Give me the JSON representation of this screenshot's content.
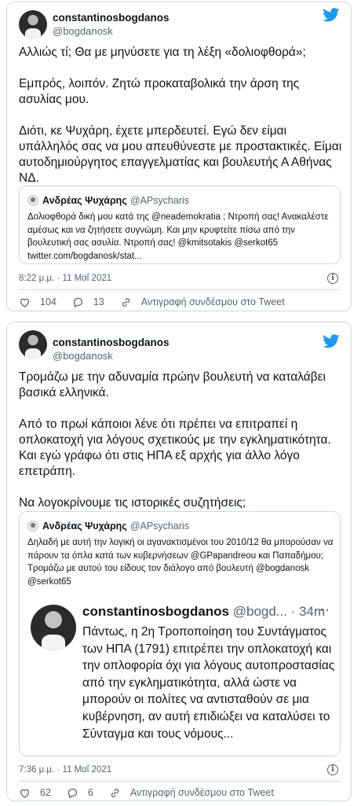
{
  "tweets": [
    {
      "author_name": "constantinosbogdanos",
      "author_handle": "@bogdanosk",
      "text": [
        "Αλλιώς τί; Θα με μηνύσετε για τη λέξη «δολιοφθορά»;",
        "Εμπρός, λοιπόν. Ζητώ προκαταβολικά την άρση της ασυλίας μου.",
        "Διότι, κε Ψυχάρη, έχετε μπερδευτεί. Εγώ δεν είμαι υπάλληλός σας να μου απευθύνεστε με προστακτικές. Είμαι αυτοδημιούργητος επαγγελματίας και βουλευτής Α Αθήνας ΝΔ."
      ],
      "quote": {
        "name": "Ανδρέας Ψυχάρης",
        "handle": "@APsycharis",
        "text": "Δολιοφθορά δική μου κατά της @neademokratia ; Ντροπή σας! Ανακαλέστε αμέσως και να ζητήσετε συγνώμη. Και μην κρυφτείτε πίσω από την βουλευτική σας ασυλία.  Ντροπή σας! @kmitsotakis @serkot65 twitter.com/bogdanosk/stat..."
      },
      "timestamp": "8:22 μ.μ. · 11 Μαΐ 2021",
      "likes": "104",
      "replies": "13",
      "copy_link": "Αντιγραφή συνδέσμου στο Tweet"
    },
    {
      "author_name": "constantinosbogdanos",
      "author_handle": "@bogdanosk",
      "text": [
        "Τρομάζω με την αδυναμία πρώην βουλευτή να καταλάβει βασικά ελληνικά.",
        "Από το πρωί κάποιοι λένε ότι πρέπει να επιτραπεί η οπλοκατοχή για λόγους σχετικούς με την εγκληματικότητα. Και εγώ γράφω ότι στις ΗΠΑ εξ αρχής για άλλο λόγο επετράπη.",
        "Να λογοκρίνουμε τις ιστορικές συζητήσεις;"
      ],
      "quote": {
        "name": "Ανδρέας Ψυχάρης",
        "handle": "@APsycharis",
        "text": "Δηλαδή με αυτή την λογική οι αγανακτισμένοι του 2010/12 θα μπορούσαν να πάρουν τα όπλα κατά των κυβερνήσεων @GPapandreou και Παπαδήμου; Τρομάζω με αυτού του είδους τον διάλογο από βουλευτή @bogdanosk @serkot65",
        "embedded": {
          "name": "constantinosbogdanos",
          "handle": "@bogd...",
          "time": "· 34m",
          "text": "Πάντως, η 2η Τροποποίηση του Συντάγματος των ΗΠΑ (1791) επιτρέπει την οπλοκατοχή και την οπλοφορία όχι για λόγους αυτοπροστασίας από την εγκληματικότητα, αλλά ώστε να μπορούν οι πολίτες να αντισταθούν σε μια κυβέρνηση, αν αυτή επιδιώξει να καταλύσει το Σύνταγμα και τους νόμους..."
        }
      },
      "timestamp": "7:36 μ.μ. · 11 Μαΐ 2021",
      "likes": "62",
      "replies": "6",
      "copy_link": "Αντιγραφή συνδέσμου στο Tweet"
    }
  ],
  "icons": {
    "logo": "twitter-bird-icon",
    "like": "heart-icon",
    "reply": "comment-icon",
    "copy": "link-icon",
    "info": "info-icon"
  },
  "colors": {
    "twitter_blue": "#1d9bf0",
    "text": "#0f1419",
    "muted": "#536471",
    "border": "#cfd9de"
  }
}
